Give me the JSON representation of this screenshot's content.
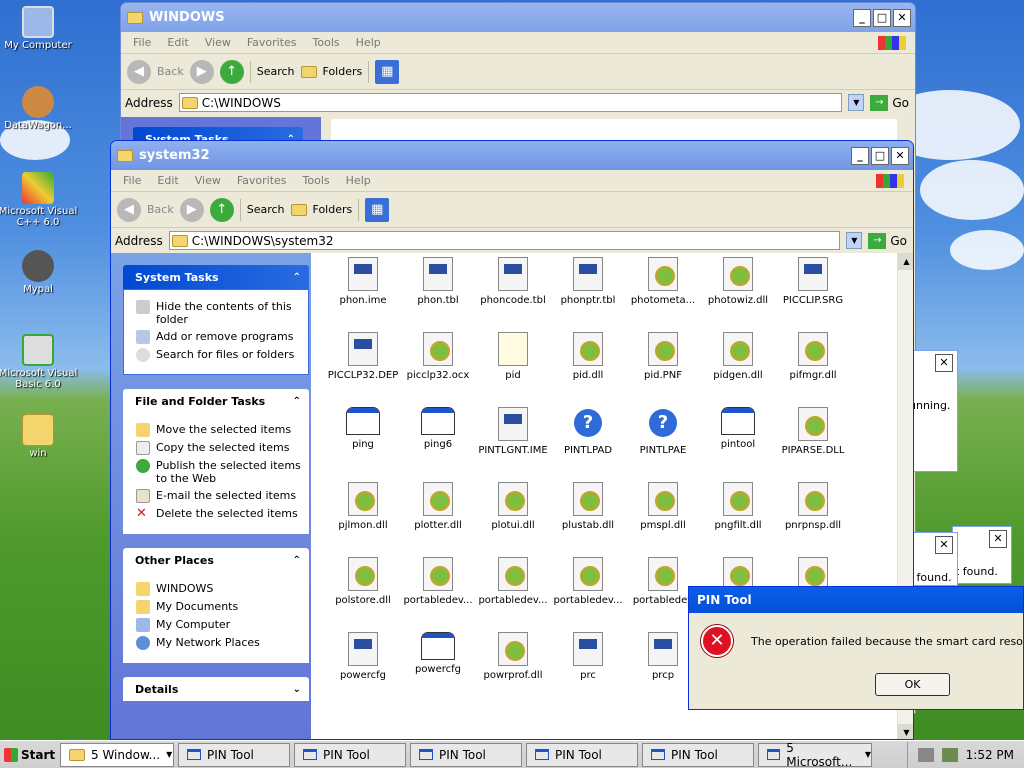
{
  "desktop": {
    "icons": [
      {
        "label": "My Computer"
      },
      {
        "label": "DataWagon..."
      },
      {
        "label": "Microsoft Visual C++ 6.0"
      },
      {
        "label": "Mypal"
      },
      {
        "label": "Microsoft Visual Basic 6.0"
      },
      {
        "label": "win"
      }
    ]
  },
  "back_window": {
    "title": "WINDOWS",
    "menu": [
      "File",
      "Edit",
      "View",
      "Favorites",
      "Tools",
      "Help"
    ],
    "toolbar": {
      "back": "Back",
      "search": "Search",
      "folders": "Folders"
    },
    "address_label": "Address",
    "address_value": "C:\\WINDOWS",
    "go_label": "Go",
    "tasks_header": "System Tasks"
  },
  "front_window": {
    "title": "system32",
    "menu": [
      "File",
      "Edit",
      "View",
      "Favorites",
      "Tools",
      "Help"
    ],
    "toolbar": {
      "back": "Back",
      "search": "Search",
      "folders": "Folders"
    },
    "address_label": "Address",
    "address_value": "C:\\WINDOWS\\system32",
    "go_label": "Go",
    "panels": {
      "system_tasks": {
        "title": "System Tasks",
        "items": [
          "Hide the contents of this folder",
          "Add or remove programs",
          "Search for files or folders"
        ]
      },
      "file_tasks": {
        "title": "File and Folder Tasks",
        "items": [
          "Move the selected items",
          "Copy the selected items",
          "Publish the selected items to the Web",
          "E-mail the selected items",
          "Delete the selected items"
        ]
      },
      "other_places": {
        "title": "Other Places",
        "items": [
          "WINDOWS",
          "My Documents",
          "My Computer",
          "My Network Places"
        ]
      },
      "details": {
        "title": "Details"
      }
    },
    "files": [
      {
        "name": "phon.ime",
        "icon": "ime"
      },
      {
        "name": "phon.tbl",
        "icon": "ime"
      },
      {
        "name": "phoncode.tbl",
        "icon": "ime"
      },
      {
        "name": "phonptr.tbl",
        "icon": "ime"
      },
      {
        "name": "photometa...",
        "icon": "gear"
      },
      {
        "name": "photowiz.dll",
        "icon": "gear"
      },
      {
        "name": "PICCLIP.SRG",
        "icon": "ime"
      },
      {
        "name": "PICCLP32.DEP",
        "icon": "ime"
      },
      {
        "name": "picclp32.ocx",
        "icon": "gear"
      },
      {
        "name": "pid",
        "icon": "note"
      },
      {
        "name": "pid.dll",
        "icon": "gear"
      },
      {
        "name": "pid.PNF",
        "icon": "gear"
      },
      {
        "name": "pidgen.dll",
        "icon": "gear"
      },
      {
        "name": "pifmgr.dll",
        "icon": "gear"
      },
      {
        "name": "ping",
        "icon": "win"
      },
      {
        "name": "ping6",
        "icon": "win"
      },
      {
        "name": "PINTLGNT.IME",
        "icon": "ime"
      },
      {
        "name": "PINTLPAD",
        "icon": "help"
      },
      {
        "name": "PINTLPAE",
        "icon": "help"
      },
      {
        "name": "pintool",
        "icon": "win"
      },
      {
        "name": "PIPARSE.DLL",
        "icon": "gear"
      },
      {
        "name": "pjlmon.dll",
        "icon": "gear"
      },
      {
        "name": "plotter.dll",
        "icon": "gear"
      },
      {
        "name": "plotui.dll",
        "icon": "gear"
      },
      {
        "name": "plustab.dll",
        "icon": "gear"
      },
      {
        "name": "pmspl.dll",
        "icon": "gear"
      },
      {
        "name": "pngfilt.dll",
        "icon": "gear"
      },
      {
        "name": "pnrpnsp.dll",
        "icon": "gear"
      },
      {
        "name": "polstore.dll",
        "icon": "gear"
      },
      {
        "name": "portabledev...",
        "icon": "gear"
      },
      {
        "name": "portabledev...",
        "icon": "gear"
      },
      {
        "name": "portabledev...",
        "icon": "gear"
      },
      {
        "name": "portabledev",
        "icon": "gear"
      },
      {
        "name": "",
        "icon": "gear"
      },
      {
        "name": "",
        "icon": "gear"
      },
      {
        "name": "powercfg",
        "icon": "ime"
      },
      {
        "name": "powercfg",
        "icon": "win"
      },
      {
        "name": "powrprof.dll",
        "icon": "gear"
      },
      {
        "name": "prc",
        "icon": "ime"
      },
      {
        "name": "prcp",
        "icon": "ime"
      }
    ]
  },
  "dialog": {
    "title": "PIN Tool",
    "message": "The operation failed because the smart card resource ma",
    "ok_label": "OK"
  },
  "background_dialogs": [
    "unning.",
    "t found.",
    "c found."
  ],
  "taskbar": {
    "start_label": "Start",
    "items": [
      "5 Window...",
      "PIN Tool",
      "PIN Tool",
      "PIN Tool",
      "PIN Tool",
      "PIN Tool",
      "5 Microsoft..."
    ],
    "clock": "1:52 PM"
  }
}
